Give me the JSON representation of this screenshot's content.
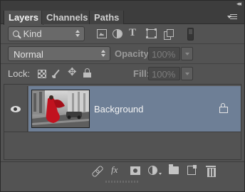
{
  "window": {
    "collapse_glyph": "◂◂",
    "close_glyph": "✕"
  },
  "tabs": [
    {
      "label": "Layers",
      "active": true
    },
    {
      "label": "Channels",
      "active": false
    },
    {
      "label": "Paths",
      "active": false
    }
  ],
  "filter": {
    "kind_label": "Kind",
    "type_glyph": "T"
  },
  "blend": {
    "mode": "Normal",
    "opacity_label": "Opacity:",
    "opacity_value": "100%",
    "fill_label": "Fill:",
    "fill_value": "100%"
  },
  "lock": {
    "label": "Lock:",
    "move_glyph": "✥"
  },
  "layers": [
    {
      "name": "Background",
      "visible": true,
      "locked": true,
      "selected": true
    }
  ],
  "bottom": {
    "fx_label": "fx"
  },
  "colors": {
    "panel_bg": "#535353",
    "selected_row": "#6e7f96",
    "text": "#d6d6d6"
  }
}
